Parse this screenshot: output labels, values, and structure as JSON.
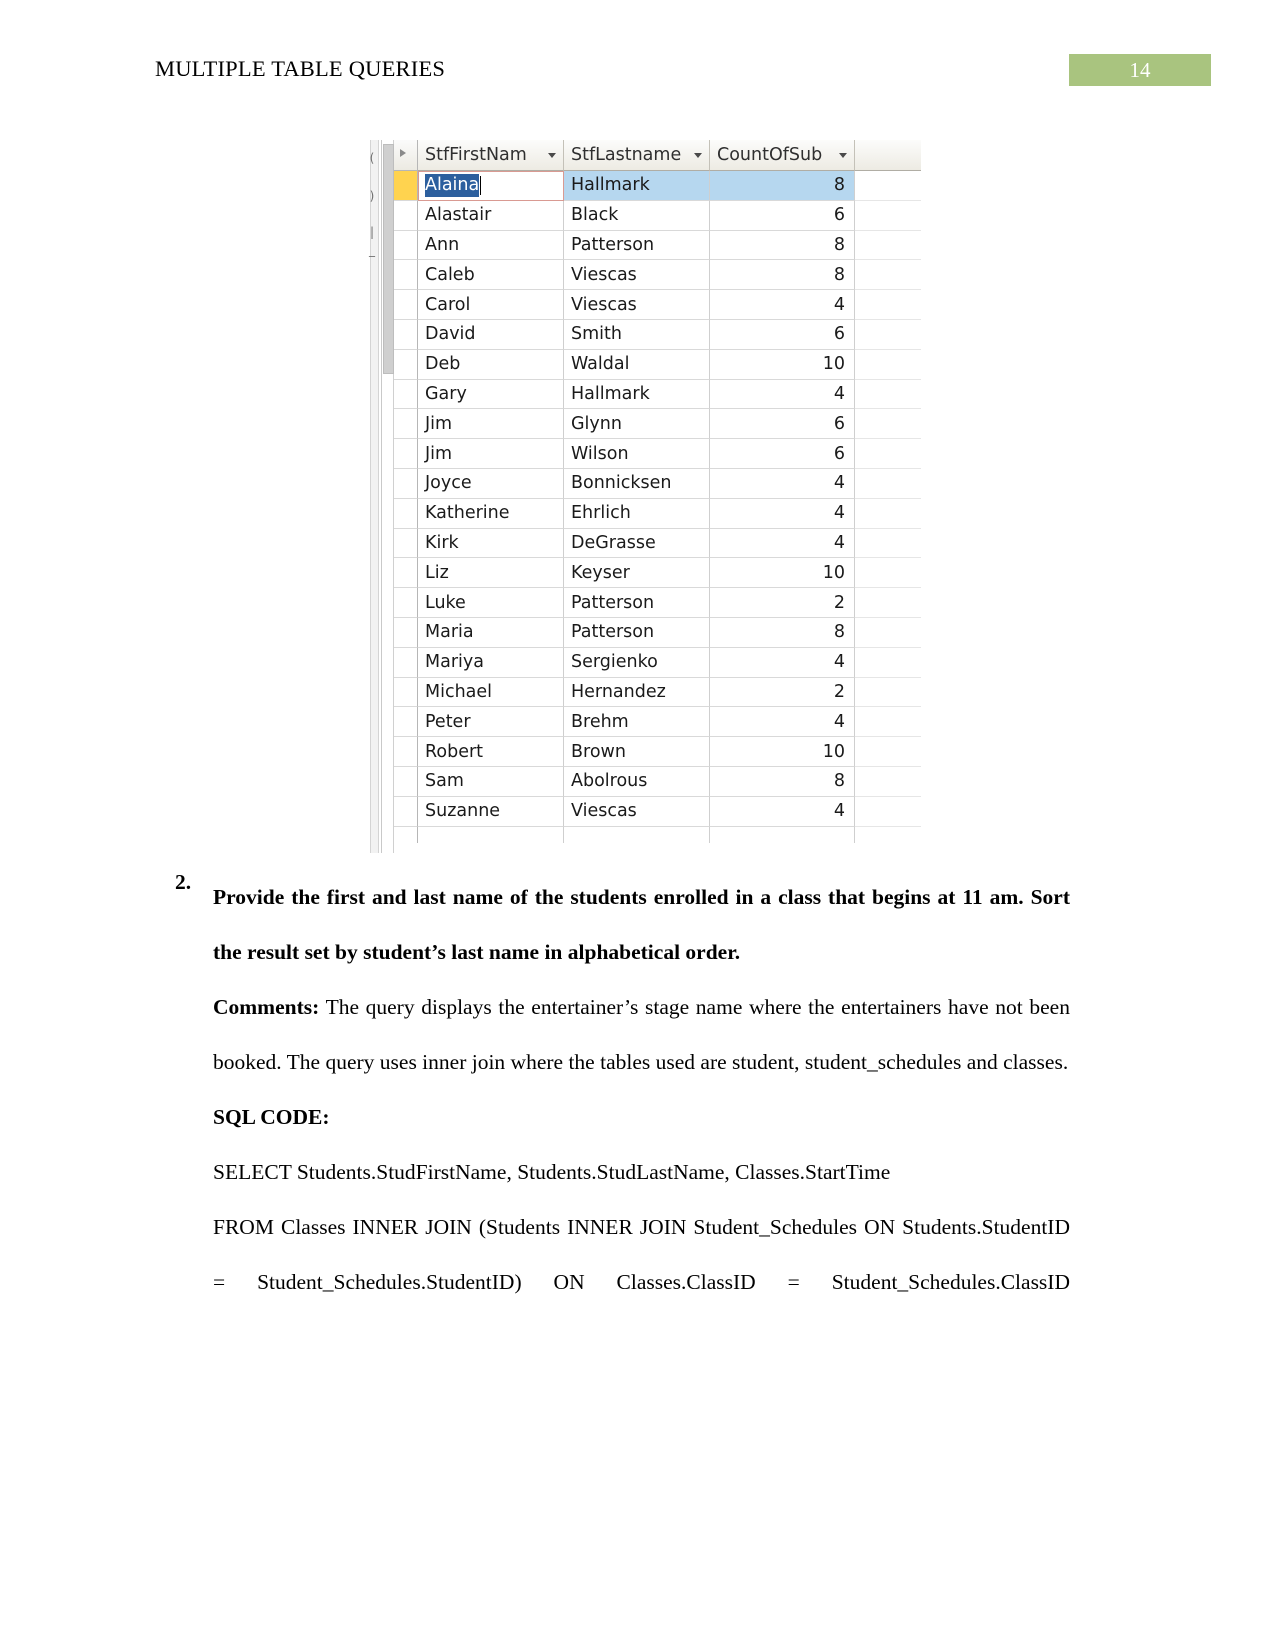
{
  "header": {
    "title": "MULTIPLE TABLE QUERIES",
    "page_number": "14",
    "badge_color": "#a9c47f"
  },
  "screenshot": {
    "app": "Microsoft Access datasheet",
    "columns": [
      {
        "label": "StfFirstNam",
        "name": "stffirstname"
      },
      {
        "label": "StfLastname",
        "name": "stflastname"
      },
      {
        "label": "CountOfSub",
        "name": "countofsub"
      }
    ],
    "selected_cell_text": "Alaina",
    "rows": [
      {
        "first": "Alaina",
        "last": "Hallmark",
        "count": "8"
      },
      {
        "first": "Alastair",
        "last": "Black",
        "count": "6"
      },
      {
        "first": "Ann",
        "last": "Patterson",
        "count": "8"
      },
      {
        "first": "Caleb",
        "last": "Viescas",
        "count": "8"
      },
      {
        "first": "Carol",
        "last": "Viescas",
        "count": "4"
      },
      {
        "first": "David",
        "last": "Smith",
        "count": "6"
      },
      {
        "first": "Deb",
        "last": "Waldal",
        "count": "10"
      },
      {
        "first": "Gary",
        "last": "Hallmark",
        "count": "4"
      },
      {
        "first": "Jim",
        "last": "Glynn",
        "count": "6"
      },
      {
        "first": "Jim",
        "last": "Wilson",
        "count": "6"
      },
      {
        "first": "Joyce",
        "last": "Bonnicksen",
        "count": "4"
      },
      {
        "first": "Katherine",
        "last": "Ehrlich",
        "count": "4"
      },
      {
        "first": "Kirk",
        "last": "DeGrasse",
        "count": "4"
      },
      {
        "first": "Liz",
        "last": "Keyser",
        "count": "10"
      },
      {
        "first": "Luke",
        "last": "Patterson",
        "count": "2"
      },
      {
        "first": "Maria",
        "last": "Patterson",
        "count": "8"
      },
      {
        "first": "Mariya",
        "last": "Sergienko",
        "count": "4"
      },
      {
        "first": "Michael",
        "last": "Hernandez",
        "count": "2"
      },
      {
        "first": "Peter",
        "last": "Brehm",
        "count": "4"
      },
      {
        "first": "Robert",
        "last": "Brown",
        "count": "10"
      },
      {
        "first": "Sam",
        "last": "Abolrous",
        "count": "8"
      },
      {
        "first": "Suzanne",
        "last": "Viescas",
        "count": "4"
      }
    ],
    "nav_glyphs": [
      "(",
      ")",
      "|",
      "_"
    ],
    "selection_highlight_color": "#b6d7ef",
    "row_selector_color": "#ffd34f"
  },
  "content": {
    "question_number": "2.",
    "question_text": "Provide the first and last name of the students enrolled in a class that begins at 11 am. Sort the result set by student’s last name in alphabetical order.",
    "comments_label": "Comments:",
    "comments_text": "The query displays the entertainer’s stage name where the entertainers have not been booked. The query uses inner join where the tables used are student, student_schedules and classes.",
    "sql_heading": "SQL CODE:",
    "sql_lines": [
      "SELECT Students.StudFirstName, Students.StudLastName, Classes.StartTime",
      "FROM Classes INNER JOIN (Students INNER JOIN Student_Schedules ON Students.StudentID = Student_Schedules.StudentID) ON Classes.ClassID = Student_Schedules.ClassID"
    ]
  }
}
